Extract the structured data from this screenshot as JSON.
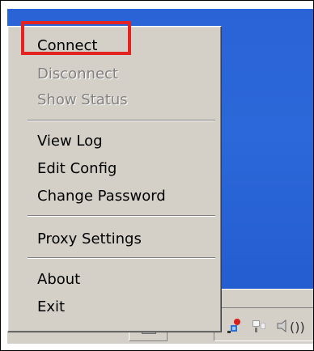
{
  "menu": {
    "items": [
      {
        "label": "Connect",
        "enabled": true
      },
      {
        "label": "Disconnect",
        "enabled": false
      },
      {
        "label": "Show Status",
        "enabled": false
      },
      {
        "label": "View Log",
        "enabled": true
      },
      {
        "label": "Edit Config",
        "enabled": true
      },
      {
        "label": "Change Password",
        "enabled": true
      },
      {
        "label": "Proxy Settings",
        "enabled": true
      },
      {
        "label": "About",
        "enabled": true
      },
      {
        "label": "Exit",
        "enabled": true
      }
    ]
  },
  "highlight": {
    "target": "Connect",
    "color": "#e32222"
  },
  "taskbar": {
    "tray_icons": [
      "network-icon",
      "monitor-icon",
      "volume-icon"
    ],
    "tray_text": "())"
  },
  "colors": {
    "desktop": "#2a63d6",
    "menu_background": "#d4d0c8"
  }
}
